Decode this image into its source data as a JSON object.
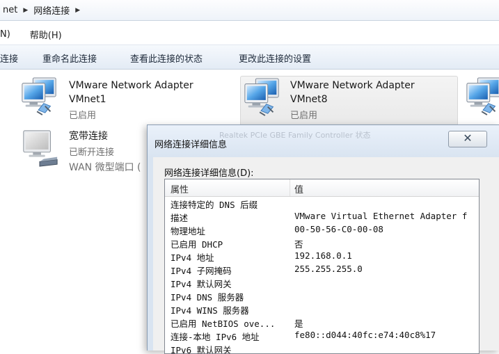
{
  "breadcrumb": {
    "seg1": "net",
    "seg2": "网络连接"
  },
  "menu": {
    "view_partial": "N)",
    "help": "帮助(H)"
  },
  "commands": {
    "connect_partial": "连接",
    "rename": "重命名此连接",
    "view_status": "查看此连接的状态",
    "change_settings": "更改此连接的设置"
  },
  "adapters": [
    {
      "name_line1": "VMware Network Adapter",
      "name_line2": "VMnet1",
      "status": "已启用",
      "icon": "network-adapter-icon"
    },
    {
      "name_line1": "VMware Network Adapter",
      "name_line2": "VMnet8",
      "status": "已启用",
      "icon": "network-adapter-icon",
      "selected": true
    },
    {
      "name_line1": "宽带连接",
      "status": "已断开连接",
      "device": "WAN 微型端口 (",
      "icon": "broadband-connection-icon"
    }
  ],
  "dialog": {
    "title": "网络连接详细信息",
    "ghost_text": "Realtek PCIe GBE Family Controller 状态",
    "close_glyph": "✕",
    "list_label": "网络连接详细信息(D):",
    "columns": [
      "属性",
      "值"
    ],
    "rows": [
      {
        "property": "连接特定的 DNS 后缀",
        "value": ""
      },
      {
        "property": "描述",
        "value": "VMware Virtual Ethernet Adapter f"
      },
      {
        "property": "物理地址",
        "value": "00-50-56-C0-00-08"
      },
      {
        "property": "已启用 DHCP",
        "value": "否"
      },
      {
        "property": "IPv4 地址",
        "value": "192.168.0.1"
      },
      {
        "property": "IPv4 子网掩码",
        "value": "255.255.255.0"
      },
      {
        "property": "IPv4 默认网关",
        "value": ""
      },
      {
        "property": "IPv4 DNS 服务器",
        "value": ""
      },
      {
        "property": "IPv4 WINS 服务器",
        "value": ""
      },
      {
        "property": "已启用 NetBIOS ove...",
        "value": "是"
      },
      {
        "property": "连接-本地 IPv6 地址",
        "value": "fe80::d044:40fc:e74:40c8%17"
      },
      {
        "property": "IPv6 默认网关",
        "value": ""
      }
    ]
  }
}
